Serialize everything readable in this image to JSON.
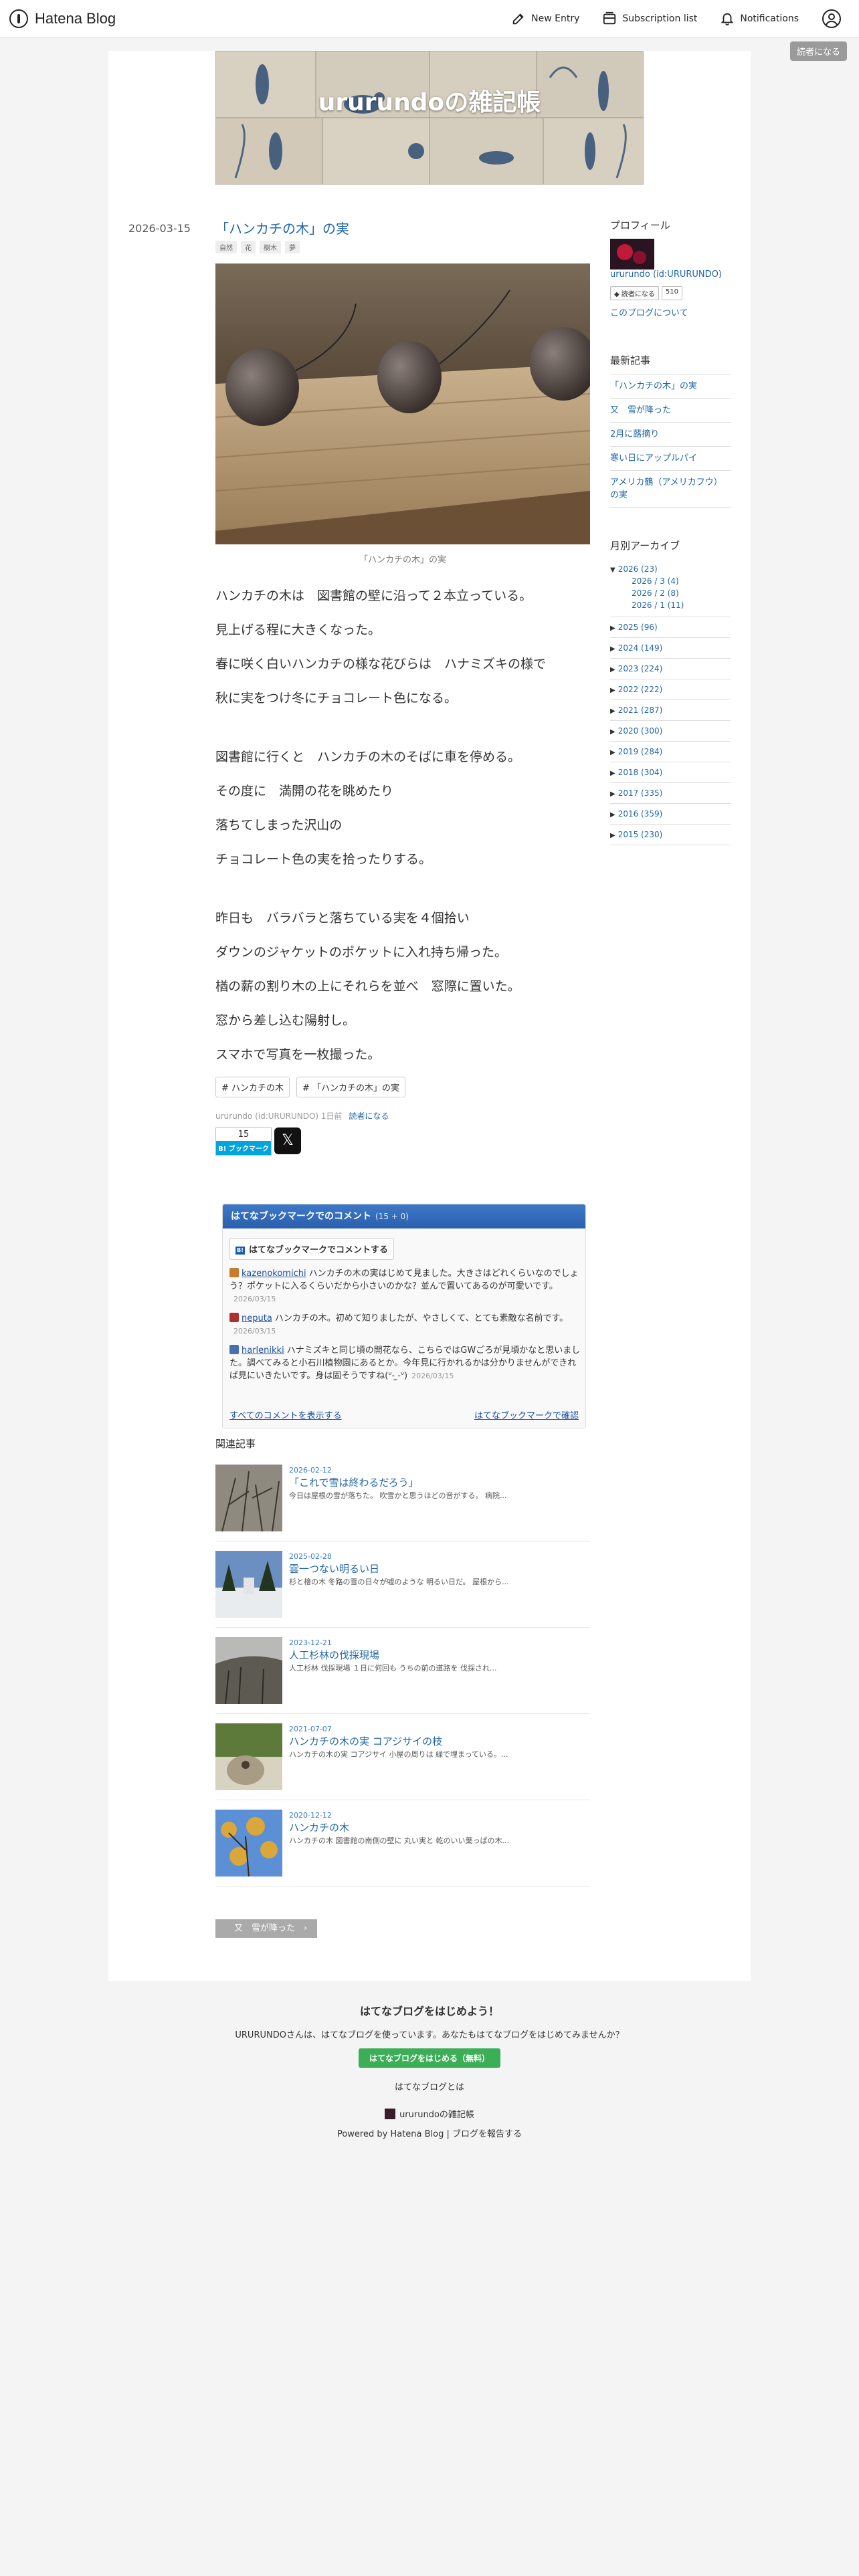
{
  "global_header": {
    "brand": "Hatena Blog",
    "nav": [
      {
        "label": "New Entry",
        "icon": "edit-icon"
      },
      {
        "label": "Subscription list",
        "icon": "subscriptions-icon"
      },
      {
        "label": "Notifications",
        "icon": "bell-icon"
      }
    ],
    "user_icon": "user-icon",
    "reader_button": "読者になる"
  },
  "blog": {
    "title": "ururundoの雑記帳"
  },
  "entry": {
    "date": "2026-03-15",
    "title": "「ハンカチの木」の実",
    "categories": [
      "自然",
      "花",
      "樹木",
      "夢"
    ],
    "caption": "「ハンカチの木」の実",
    "paragraphs": [
      [
        "ハンカチの木は　図書館の壁に沿って２本立っている。",
        "見上げる程に大きくなった。",
        "春に咲く白いハンカチの様な花びらは　ハナミズキの様で",
        "秋に実をつけ冬にチョコレート色になる。"
      ],
      [
        "図書館に行くと　ハンカチの木のそばに車を停める。",
        "その度に　満開の花を眺めたり",
        "落ちてしまった沢山の",
        "チョコレート色の実を拾ったりする。"
      ],
      [
        "昨日も　バラバラと落ちている実を４個拾い",
        "ダウンのジャケットのポケットに入れ持ち帰った。",
        "楢の薪の割り木の上にそれらを並べ　窓際に置いた。",
        "窓から差し込む陽射し。",
        "スマホで写真を一枚撮った。"
      ]
    ],
    "tags": [
      "# ハンカチの木",
      "# 「ハンカチの木」の実"
    ],
    "author_line": "ururundo (id:URURUNDO) 1日前",
    "reader_link": "読者になる",
    "bookmark_count": "15",
    "bookmark_label": "B! ブックマーク",
    "x_label": "𝕏"
  },
  "bookmarks": {
    "title": "はてなブックマークでのコメント",
    "count": "(15 + 0)",
    "comment_button": "はてなブックマークでコメントする",
    "comments": [
      {
        "user": "kazenokomichi",
        "text": "ハンカチの木の実はじめて見ました。大きさはどれくらいなのでしょう？ポケットに入るくらいだから小さいのかな？並んで置いてあるのが可愛いです。",
        "date": "2026/03/15",
        "color": "#c97a2a"
      },
      {
        "user": "neputa",
        "text": "ハンカチの木。初めて知りましたが、やさしくて、とても素敵な名前です。",
        "date": "2026/03/15",
        "color": "#b03030"
      },
      {
        "user": "harlenikki",
        "text": "ハナミズキと同じ頃の開花なら、こちらではGWごろが見頃かなと思いました。調べてみると小石川植物園にあるとか。今年見に行かれるかは分かりませんができれば見にいきたいです。身は固そうですね(ᐡ- ̫-ᐡ)",
        "date": "2026/03/15",
        "color": "#4a6fb0"
      }
    ],
    "show_all": "すべてのコメントを表示する",
    "confirm": "はてなブックマークで確認"
  },
  "related": {
    "heading": "関連記事",
    "items": [
      {
        "date": "2026-02-12",
        "title": "「これで雪は終わるだろう」",
        "snippet": "今日は屋根の雪が落ちた。 吹雪かと思うほどの音がする。 病院..."
      },
      {
        "date": "2025-02-28",
        "title": "雲一つない明るい日",
        "snippet": "杉と檜の木 冬路の雪の日々が嘘のような 明るい日だ。 屋根から..."
      },
      {
        "date": "2023-12-21",
        "title": "人工杉林の伐採現場",
        "snippet": "人工杉林 伐採現場 １日に何回も うちの前の道路を 伐採され..."
      },
      {
        "date": "2021-07-07",
        "title": "ハンカチの木の実 コアジサイの枝",
        "snippet": "ハンカチの木の実 コアジサイ 小屋の周りは 緑で埋まっている。..."
      },
      {
        "date": "2020-12-12",
        "title": "ハンカチの木",
        "snippet": "ハンカチの木 図書館の南側の壁に 丸い実と 乾のいい葉っぱの木..."
      }
    ]
  },
  "pager": {
    "label": "又　雪が降った　›"
  },
  "sidebar": {
    "profile": {
      "heading": "プロフィール",
      "name": "ururundo (id:URURUNDO)",
      "subscribe": "◆ 読者になる",
      "count": "510",
      "about": "このブログについて"
    },
    "recent": {
      "heading": "最新記事",
      "items": [
        "「ハンカチの木」の実",
        "又　雪が降った",
        "2月に蕗摘り",
        "寒い日にアップルパイ",
        "アメリカ鶴（アメリカフウ）の実"
      ]
    },
    "archive": {
      "heading": "月別アーカイブ",
      "open_year": "2026 (23)",
      "months": [
        "2026 / 3 (4)",
        "2026 / 2 (8)",
        "2026 / 1 (11)"
      ],
      "years": [
        "2025 (96)",
        "2024 (149)",
        "2023 (224)",
        "2022 (222)",
        "2021 (287)",
        "2020 (300)",
        "2019 (284)",
        "2018 (304)",
        "2017 (335)",
        "2016 (359)",
        "2015 (230)"
      ]
    }
  },
  "footer": {
    "heading": "はてなブログをはじめよう！",
    "text": "URURUNDOさんは、はてなブログを使っています。あなたもはてなブログをはじめてみませんか？",
    "start_button": "はてなブログをはじめる（無料）",
    "what": "はてなブログとは",
    "blog_name": "ururundoの雑記帳",
    "powered": "Powered by Hatena Blog | ブログを報告する"
  },
  "colors": {
    "accent": "#2266aa",
    "bookmark_blue": "#00a4de",
    "start_green": "#3bae56"
  }
}
